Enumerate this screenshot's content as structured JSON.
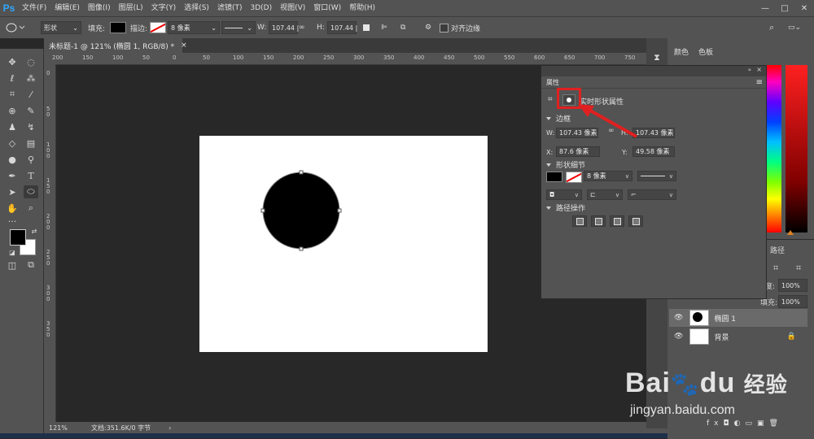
{
  "app": {
    "logo": "Ps"
  },
  "menu": [
    "文件(F)",
    "编辑(E)",
    "图像(I)",
    "图层(L)",
    "文字(Y)",
    "选择(S)",
    "滤镜(T)",
    "3D(D)",
    "视图(V)",
    "窗口(W)",
    "帮助(H)"
  ],
  "window_controls": [
    "—",
    "□",
    "✕"
  ],
  "options": {
    "mode": "形状",
    "fill_label": "填充:",
    "stroke_label": "描边:",
    "stroke_width": "8 像素",
    "w_label": "W:",
    "w_value": "107.44 |",
    "h_label": "H:",
    "h_value": "107.44 |",
    "align_edges": "对齐边缘"
  },
  "document": {
    "tab_title": "未标题-1 @ 121% (椭圆 1, RGB/8) *",
    "zoom": "121%",
    "doc_info": "文档:351.6K/0 字节",
    "canvas_bg": "#ffffff",
    "shape_color": "#000000"
  },
  "ruler": {
    "top": [
      "200",
      "150",
      "100",
      "50",
      "0",
      "50",
      "100",
      "150",
      "200",
      "250",
      "300",
      "350",
      "400",
      "450",
      "500",
      "550",
      "600",
      "650",
      "700",
      "750"
    ],
    "left": [
      "0",
      "5\n0",
      "1\n0\n0",
      "1\n5\n0",
      "2\n0\n0",
      "2\n5\n0",
      "3\n0\n0",
      "3\n5\n0"
    ]
  },
  "properties": {
    "title": "属性",
    "header_label": "实时形状属性",
    "sections": {
      "bounds": "边框",
      "shape_details": "形状细节",
      "path_ops": "路径操作"
    },
    "w_label": "W:",
    "w_value": "107.43 像素",
    "h_label": "H:",
    "h_value": "107.43 像素",
    "x_label": "X:",
    "x_value": "87.6 像素",
    "y_label": "Y:",
    "y_value": "49.58 像素",
    "stroke_width": "8 像素"
  },
  "panels": {
    "color_tab": "颜色",
    "swatches_tab": "色板",
    "paths_tab": "路径",
    "opacity_label": "度:",
    "opacity": "100%",
    "fill_label": "填充:",
    "fill": "100%"
  },
  "layers": [
    {
      "name": "椭圆 1",
      "selected": true
    },
    {
      "name": "背景",
      "selected": false
    }
  ],
  "watermark": {
    "brand": "Bai",
    "brand2": "du",
    "cn": "经验",
    "url": "jingyan.baidu.com"
  },
  "colors": {
    "accent_red": "#e02020",
    "ps_blue": "#31a8ff"
  }
}
